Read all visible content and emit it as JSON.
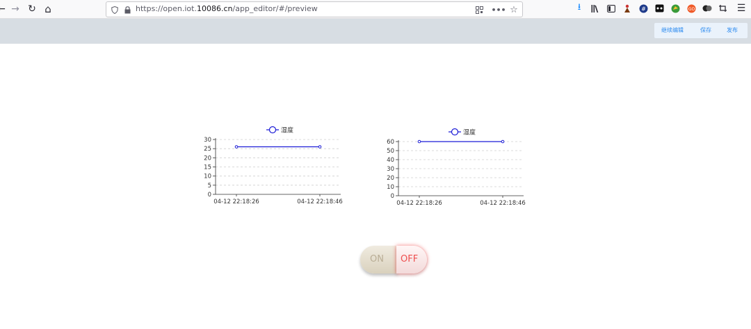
{
  "browser": {
    "url_prefix": "https://open.iot.",
    "url_host": "10086.cn",
    "url_path": "/app_editor/#/preview",
    "nav": {
      "back": "←",
      "forward": "→",
      "reload": "↻",
      "home": "⌂"
    },
    "icons": [
      "download-icon",
      "library-icon",
      "sidebar-icon",
      "extension-icon",
      "extension-icon",
      "extension-icon",
      "extension-icon",
      "extension-icon",
      "extension-icon",
      "extension-icon",
      "menu-icon"
    ]
  },
  "header": {
    "continue_edit": "继续编辑",
    "save": "保存",
    "publish": "发布"
  },
  "charts": [
    {
      "legend": "湿度"
    },
    {
      "legend": "湿度"
    }
  ],
  "chart_data": [
    {
      "type": "line",
      "x": [
        "04-12 22:18:26",
        "04-12 22:18:46"
      ],
      "series": [
        {
          "name": "湿度",
          "values": [
            26,
            26
          ]
        }
      ],
      "yticks": [
        0,
        5,
        10,
        15,
        20,
        25,
        30
      ],
      "ylim": [
        0,
        30
      ],
      "grid": true,
      "legend_position": "top",
      "color": "#1a1ad6"
    },
    {
      "type": "line",
      "x": [
        "04-12 22:18:26",
        "04-12 22:18:46"
      ],
      "series": [
        {
          "name": "湿度",
          "values": [
            60,
            60
          ]
        }
      ],
      "yticks": [
        0,
        10,
        20,
        30,
        40,
        50,
        60
      ],
      "ylim": [
        0,
        60
      ],
      "grid": true,
      "legend_position": "top",
      "color": "#1a1ad6"
    }
  ],
  "switch": {
    "on_label": "ON",
    "off_label": "OFF",
    "state": "OFF"
  }
}
